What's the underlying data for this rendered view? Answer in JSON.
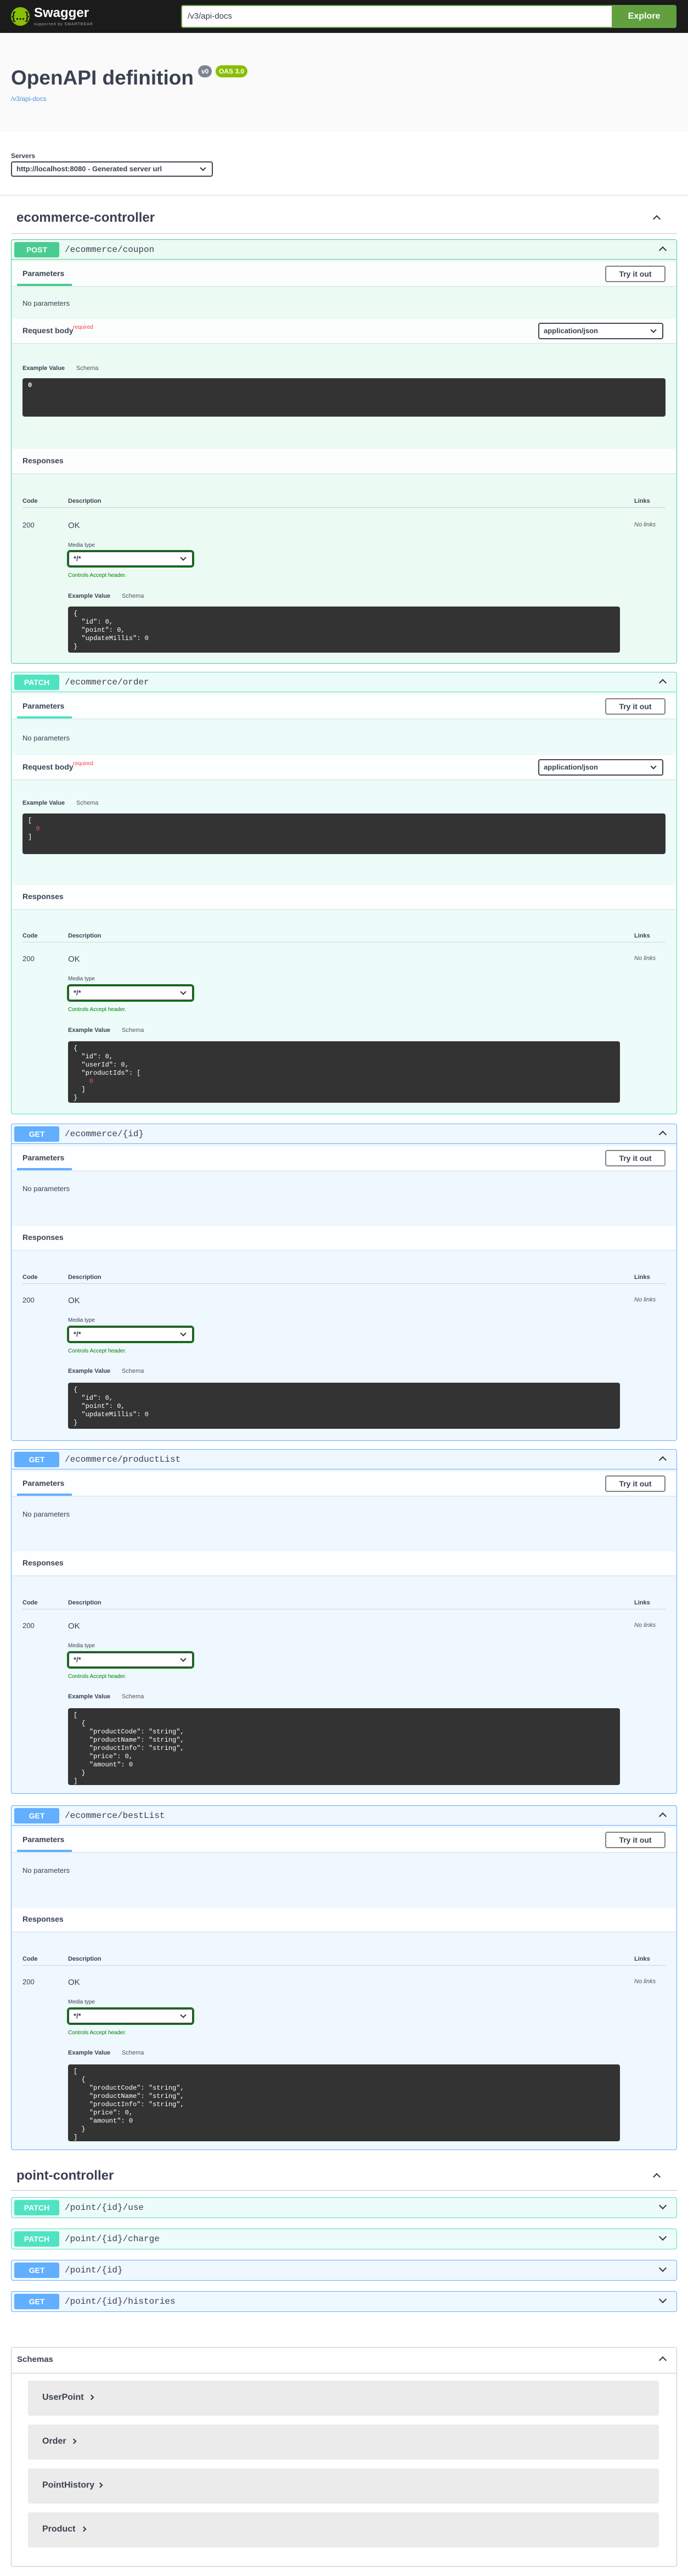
{
  "topbar": {
    "logo_mark": "{...}",
    "logo_name": "Swagger",
    "logo_sub": "supported by SMARTBEAR",
    "url_value": "/v3/api-docs",
    "explore_label": "Explore"
  },
  "info": {
    "title": "OpenAPI definition",
    "version_badge": "v0",
    "oas_badge": "OAS 3.0",
    "api_docs_link": "/v3/api-docs"
  },
  "servers": {
    "label": "Servers",
    "selected": "http://localhost:8080 - Generated server url"
  },
  "tags": [
    {
      "title": "ecommerce-controller"
    },
    {
      "title": "point-controller"
    }
  ],
  "common": {
    "parameters": "Parameters",
    "try_it_out": "Try it out",
    "no_parameters": "No parameters",
    "request_body": "Request body",
    "required": "required",
    "content_type": "application/json",
    "example_value": "Example Value",
    "schema": "Schema",
    "responses": "Responses",
    "code": "Code",
    "description": "Description",
    "links": "Links",
    "code_200": "200",
    "ok": "OK",
    "no_links": "No links",
    "media_type": "Media type",
    "media_value": "*/*",
    "controls_accept": "Controls Accept header."
  },
  "operations": [
    {
      "method": "POST",
      "path": "/ecommerce/coupon",
      "request_example": "0",
      "response_example": [
        "{",
        "  \"id\": 0,",
        "  \"point\": 0,",
        "  \"updateMillis\": 0",
        "}"
      ]
    },
    {
      "method": "PATCH",
      "path": "/ecommerce/order",
      "request_example": [
        "[",
        "  0",
        "]"
      ],
      "response_example": [
        "{",
        "  \"id\": 0,",
        "  \"userId\": 0,",
        "  \"productIds\": [",
        "    0",
        "  ]",
        "}"
      ]
    },
    {
      "method": "GET",
      "path": "/ecommerce/{id}",
      "response_example": [
        "{",
        "  \"id\": 0,",
        "  \"point\": 0,",
        "  \"updateMillis\": 0",
        "}"
      ]
    },
    {
      "method": "GET",
      "path": "/ecommerce/productList",
      "response_example": [
        "[",
        "  {",
        "    \"productCode\": \"string\",",
        "    \"productName\": \"string\",",
        "    \"productInfo\": \"string\",",
        "    \"price\": 0,",
        "    \"amount\": 0",
        "  }",
        "]"
      ]
    },
    {
      "method": "GET",
      "path": "/ecommerce/bestList",
      "response_example": [
        "[",
        "  {",
        "    \"productCode\": \"string\",",
        "    \"productName\": \"string\",",
        "    \"productInfo\": \"string\",",
        "    \"price\": 0,",
        "    \"amount\": 0",
        "  }",
        "]"
      ]
    },
    {
      "method": "PATCH",
      "path": "/point/{id}/use"
    },
    {
      "method": "PATCH",
      "path": "/point/{id}/charge"
    },
    {
      "method": "GET",
      "path": "/point/{id}"
    },
    {
      "method": "GET",
      "path": "/point/{id}/histories"
    }
  ],
  "schemas": {
    "title": "Schemas",
    "items": [
      "UserPoint",
      "Order",
      "PointHistory",
      "Product"
    ]
  }
}
